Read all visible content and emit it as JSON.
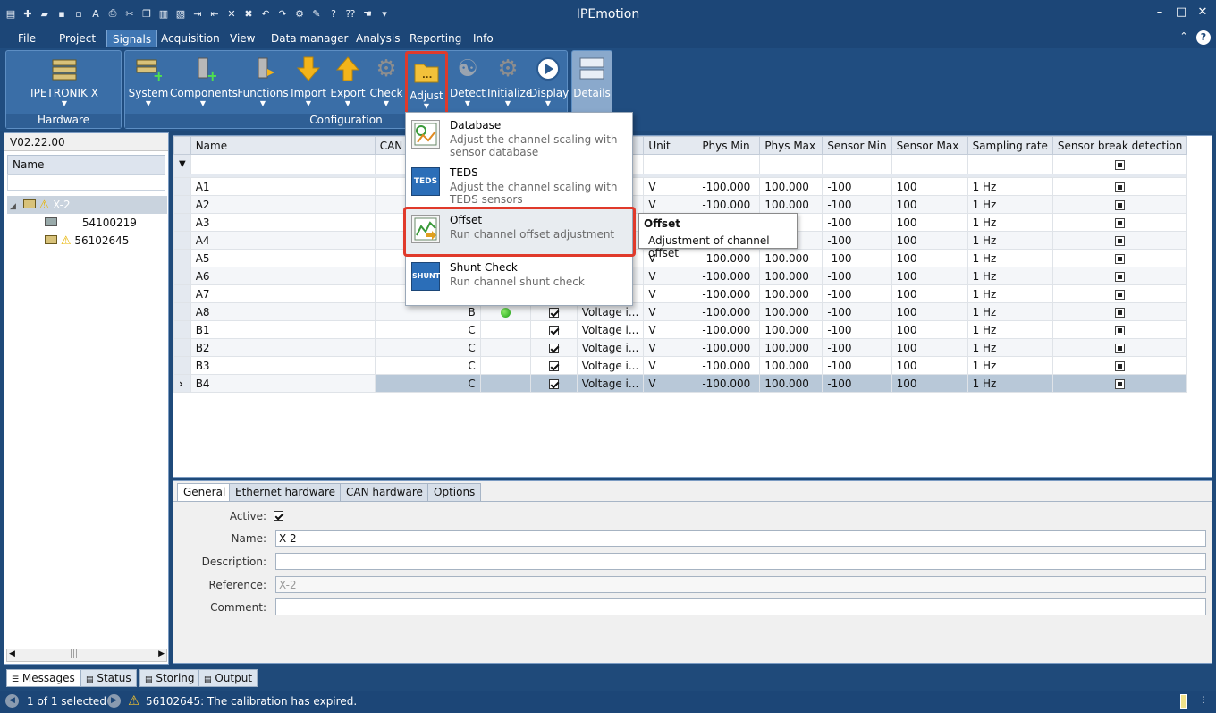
{
  "window": {
    "title": "IPEmotion",
    "controls": [
      "minimize-icon",
      "maximize-icon",
      "close-icon"
    ]
  },
  "quick_access_icons": [
    "app-icon",
    "new-icon",
    "open-icon",
    "save-icon",
    "save-as-icon",
    "auto-icon",
    "print-icon",
    "cut-icon",
    "copy-icon",
    "paste-icon",
    "paste-special-icon",
    "export-icon",
    "import-icon",
    "delete-icon",
    "tools-icon",
    "undo-icon",
    "redo-icon",
    "settings-icon",
    "wrench-icon",
    "help-icon",
    "context-help-icon",
    "hand-icon",
    "customize-icon"
  ],
  "menu": {
    "items": [
      "File",
      "Project",
      "Signals",
      "Acquisition",
      "View",
      "Data manager",
      "Analysis",
      "Reporting",
      "Info"
    ],
    "active": "Signals"
  },
  "ribbon": {
    "hardware_group": {
      "label": "Hardware",
      "buttons": [
        {
          "label": "IPETRONIK X",
          "icon": "hardware-icon"
        }
      ]
    },
    "configuration_group": {
      "label": "Configuration",
      "buttons": [
        {
          "label": "System",
          "icon": "system-icon"
        },
        {
          "label": "Components",
          "icon": "components-icon"
        },
        {
          "label": "Functions",
          "icon": "functions-icon"
        },
        {
          "label": "Import",
          "icon": "import-arrow-icon"
        },
        {
          "label": "Export",
          "icon": "export-arrow-icon"
        },
        {
          "label": "Check",
          "icon": "check-gear-icon"
        },
        {
          "label": "Adjust",
          "icon": "adjust-folder-icon"
        },
        {
          "label": "Detect",
          "icon": "detect-icon"
        },
        {
          "label": "Initialize",
          "icon": "initialize-gear-icon"
        },
        {
          "label": "Display",
          "icon": "display-play-icon"
        }
      ]
    },
    "details": {
      "label": "Details",
      "icon": "details-icon"
    }
  },
  "left_panel": {
    "version": "V02.22.00",
    "tree_header": "Name",
    "tree": [
      {
        "label": "X-2",
        "warning": true,
        "selected": true
      },
      {
        "label": "54100219",
        "warning": false
      },
      {
        "label": "56102645",
        "warning": true
      }
    ]
  },
  "grid": {
    "columns": [
      "Name",
      "CAN i",
      "",
      "",
      "",
      "Unit",
      "Phys Min",
      "Phys Max",
      "Sensor Min",
      "Sensor Max",
      "Sampling rate",
      "Sensor break detection"
    ],
    "rows": [
      {
        "name": "A1",
        "can": "",
        "led": false,
        "active": true,
        "type": "",
        "unit": "V",
        "phys_min": "-100.000",
        "phys_max": "100.000",
        "sensor_min": "-100",
        "sensor_max": "100",
        "rate": "1 Hz"
      },
      {
        "name": "A2",
        "can": "",
        "led": false,
        "active": true,
        "type": "",
        "unit": "V",
        "phys_min": "-100.000",
        "phys_max": "100.000",
        "sensor_min": "-100",
        "sensor_max": "100",
        "rate": "1 Hz"
      },
      {
        "name": "A3",
        "can": "",
        "led": false,
        "active": true,
        "type": "",
        "unit": "",
        "phys_min": "",
        "phys_max": "",
        "sensor_min": "-100",
        "sensor_max": "100",
        "rate": "1 Hz"
      },
      {
        "name": "A4",
        "can": "",
        "led": false,
        "active": true,
        "type": "",
        "unit": "",
        "phys_min": "",
        "phys_max": "",
        "sensor_min": "-100",
        "sensor_max": "100",
        "rate": "1 Hz"
      },
      {
        "name": "A5",
        "can": "",
        "led": false,
        "active": true,
        "type": "",
        "unit": "V",
        "phys_min": "-100.000",
        "phys_max": "100.000",
        "sensor_min": "-100",
        "sensor_max": "100",
        "rate": "1 Hz"
      },
      {
        "name": "A6",
        "can": "",
        "led": false,
        "active": true,
        "type": "",
        "unit": "V",
        "phys_min": "-100.000",
        "phys_max": "100.000",
        "sensor_min": "-100",
        "sensor_max": "100",
        "rate": "1 Hz"
      },
      {
        "name": "A7",
        "can": "",
        "led": false,
        "active": true,
        "type": "",
        "unit": "V",
        "phys_min": "-100.000",
        "phys_max": "100.000",
        "sensor_min": "-100",
        "sensor_max": "100",
        "rate": "1 Hz"
      },
      {
        "name": "A8",
        "can": "B",
        "led": true,
        "active": true,
        "type": "Voltage i...",
        "unit": "V",
        "phys_min": "-100.000",
        "phys_max": "100.000",
        "sensor_min": "-100",
        "sensor_max": "100",
        "rate": "1 Hz"
      },
      {
        "name": "B1",
        "can": "C",
        "led": false,
        "active": true,
        "type": "Voltage i...",
        "unit": "V",
        "phys_min": "-100.000",
        "phys_max": "100.000",
        "sensor_min": "-100",
        "sensor_max": "100",
        "rate": "1 Hz"
      },
      {
        "name": "B2",
        "can": "C",
        "led": false,
        "active": true,
        "type": "Voltage i...",
        "unit": "V",
        "phys_min": "-100.000",
        "phys_max": "100.000",
        "sensor_min": "-100",
        "sensor_max": "100",
        "rate": "1 Hz"
      },
      {
        "name": "B3",
        "can": "C",
        "led": false,
        "active": true,
        "type": "Voltage i...",
        "unit": "V",
        "phys_min": "-100.000",
        "phys_max": "100.000",
        "sensor_min": "-100",
        "sensor_max": "100",
        "rate": "1 Hz"
      },
      {
        "name": "B4",
        "can": "C",
        "led": false,
        "active": true,
        "type": "Voltage i...",
        "unit": "V",
        "phys_min": "-100.000",
        "phys_max": "100.000",
        "sensor_min": "-100",
        "sensor_max": "100",
        "rate": "1 Hz"
      }
    ]
  },
  "adjust_menu": {
    "items": [
      {
        "title": "Database",
        "desc": "Adjust the channel scaling with sensor database",
        "icon": "database-icon",
        "icon_text": ""
      },
      {
        "title": "TEDS",
        "desc": "Adjust the channel scaling with TEDS sensors",
        "icon": "teds-icon",
        "icon_text": "TEDS"
      },
      {
        "title": "Offset",
        "desc": "Run channel offset adjustment",
        "icon": "offset-icon",
        "icon_text": ""
      },
      {
        "title": "Shunt Check",
        "desc": "Run channel shunt check",
        "icon": "shunt-icon",
        "icon_text": "SHUNT"
      }
    ],
    "tooltip": {
      "title": "Offset",
      "desc": "Adjustment of channel offset"
    }
  },
  "properties": {
    "tabs": [
      "General",
      "Ethernet hardware",
      "CAN hardware",
      "Options"
    ],
    "active_label": "Active:",
    "active": true,
    "name_label": "Name:",
    "name": "X-2",
    "description_label": "Description:",
    "description": "",
    "reference_label": "Reference:",
    "reference": "X-2",
    "comment_label": "Comment:",
    "comment": ""
  },
  "bottom_tabs": [
    "Messages",
    "Status",
    "Storing",
    "Output"
  ],
  "status": {
    "selection": "1 of 1 selected",
    "message": "56102645: The calibration has expired."
  },
  "colors": {
    "chrome": "#1c4677",
    "ribbon": "#3a6ea7",
    "highlight": "#e03a2b",
    "warning": "#f2c230"
  }
}
